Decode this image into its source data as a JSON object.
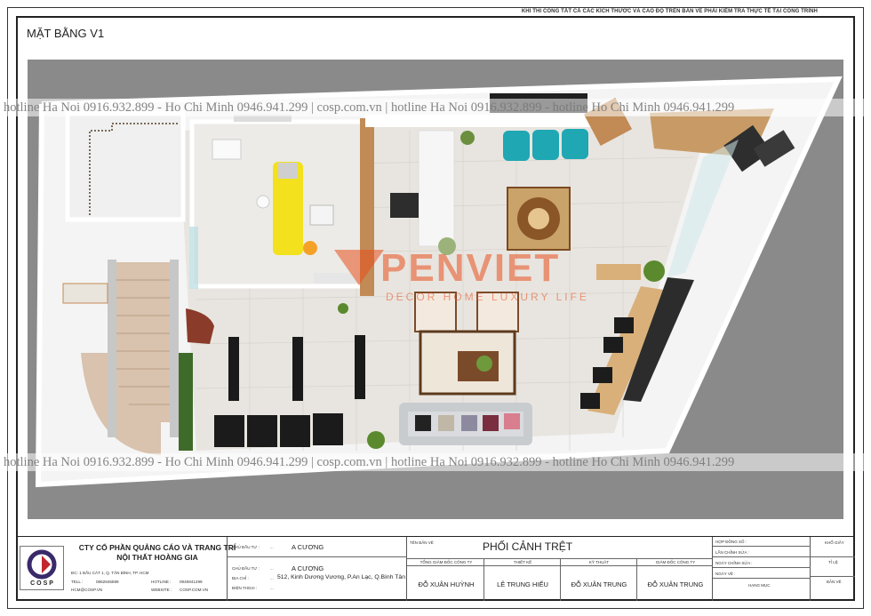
{
  "header": {
    "note": "KHI THI CÔNG TẤT CẢ CÁC KÍCH THƯỚC VÀ CAO ĐỘ TRÊN BẢN VẼ PHẢI KIỂM TRA THỰC TẾ TẠI CÔNG TRÌNH",
    "sheet_title": "MẶT BẰNG V1"
  },
  "watermark": {
    "line1": "hotline Ha Noi 0916.932.899 - Ho Chi Minh 0946.941.299 | cosp.com.vn | hotline Ha Noi 0916.932.899 - hotline Ho Chi Minh 0946.941.299",
    "line2": "hotline Ha Noi 0916.932.899 - Ho Chi Minh 0946.941.299 | cosp.com.vn | hotline Ha Noi 0916.932.899 - hotline Ho Chi Minh 0946.941.299",
    "brand": "PENVIET",
    "brand_sub": "DECOR HOME LUXURY LIFE"
  },
  "title_block": {
    "logo_text": "COSP",
    "company_line1": "CTY CỔ PHẦN QUẢNG CÁO VÀ TRANG TRÍ",
    "company_line2": "NỘI THẤT HOÀNG GIA",
    "address": "ĐC: 1 BẮU CÁT 1, Q. TÂN BÌNH, TP. HCM",
    "tel_label": "TELL :",
    "tel": "0862845599",
    "hotline_label": "HOTLINE :",
    "hotline": "0946941299",
    "email": "HCM@COSP.VN",
    "website_label": "WEBSITE :",
    "website": "COSP.COM.VN",
    "investor_label": "CHỦ ĐẦU TƯ :",
    "investor_dots": "...",
    "investor": "A    CƯƠNG",
    "investor2_label": "CHỦ ĐẦU TƯ :",
    "investor2_dots": "...",
    "investor2": "A    CƯƠNG",
    "address_label": "ĐỊA CHỈ :",
    "address_dots": "...",
    "site_address": "512, Kinh Dương Vương, P.An Lạc, Q.Bình Tân",
    "phone_label": "ĐIỆN THOẠI :",
    "phone_dots": "...",
    "drawing_label": "TÊN BẢN VẼ",
    "drawing_name": "PHỐI CẢNH TRỆT",
    "roles": [
      {
        "label": "TỔNG GIÁM ĐỐC CÔNG TY",
        "name": "ĐỖ XUÂN HUỲNH"
      },
      {
        "label": "THIẾT KẾ",
        "name": "LÊ TRUNG HIẾU"
      },
      {
        "label": "KỸ THUẬT",
        "name": "ĐỖ XUÂN TRUNG"
      },
      {
        "label": "GIÁM ĐỐC CÔNG TY",
        "name": "ĐỖ XUÂN TRUNG"
      }
    ],
    "right_fields": [
      "HỢP ĐỒNG SỐ :",
      "LẦN CHỈNH SỬA :",
      "NGÀY CHỈNH SỬA :",
      "NGÀY VẼ :",
      "HẠNG MỤC"
    ],
    "right_small": [
      "KHỔ GIẤY",
      "TỈ LỆ",
      "BẢN VẼ"
    ]
  },
  "colors": {
    "render_bg": "#8a8a8a",
    "wall": "#f2f2f2",
    "floor": "#e6e3de",
    "brand": "#e8501e"
  }
}
